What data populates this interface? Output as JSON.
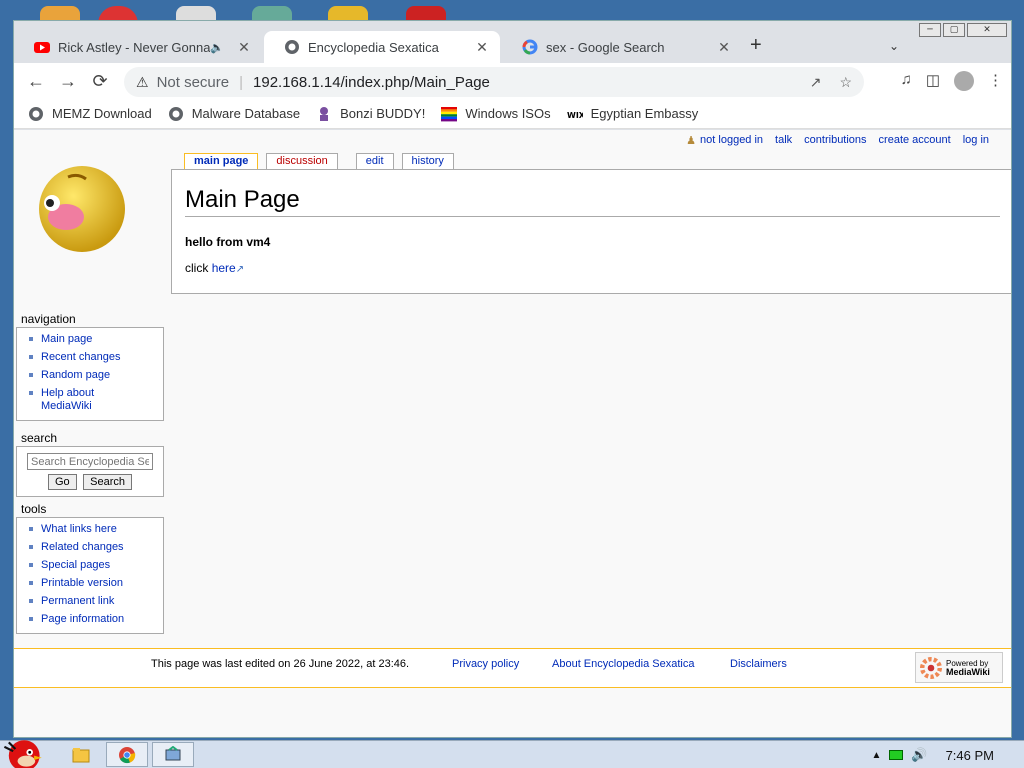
{
  "browser": {
    "tabs": [
      {
        "title": "Rick Astley - Never Gonna Give You Up",
        "icon": "youtube-icon",
        "audio": true,
        "active": false
      },
      {
        "title": "Encyclopedia Sexatica",
        "icon": "globe-icon",
        "active": true
      },
      {
        "title": "sex - Google Search",
        "icon": "google-icon",
        "active": false
      }
    ],
    "newtab_label": "+",
    "address": {
      "security_label": "Not secure",
      "url": "192.168.1.14/index.php/Main_Page"
    },
    "bookmarks": [
      {
        "label": "MEMZ Download",
        "icon": "globe-icon"
      },
      {
        "label": "Malware Database",
        "icon": "globe-icon"
      },
      {
        "label": "Bonzi BUDDY!",
        "icon": "bonzi-icon"
      },
      {
        "label": "Windows ISOs",
        "icon": "flag-icon"
      },
      {
        "label": "Egyptian Embassy",
        "icon": "wix-icon"
      }
    ]
  },
  "wiki": {
    "personal_links": [
      "not logged in",
      "talk",
      "contributions",
      "create account",
      "log in"
    ],
    "page_tabs": [
      "main page",
      "discussion",
      "edit",
      "history"
    ],
    "page_title": "Main Page",
    "greeting": "hello from vm4",
    "click_prefix": "click",
    "click_link": "here",
    "navigation": {
      "heading": "navigation",
      "items": [
        "Main page",
        "Recent changes",
        "Random page",
        "Help about MediaWiki"
      ]
    },
    "search": {
      "heading": "search",
      "placeholder": "Search Encyclopedia Sexatica",
      "go_label": "Go",
      "search_label": "Search"
    },
    "tools": {
      "heading": "tools",
      "items": [
        "What links here",
        "Related changes",
        "Special pages",
        "Printable version",
        "Permanent link",
        "Page information"
      ]
    },
    "footer": {
      "last_modified": "This page was last edited on 26 June 2022, at 23:46.",
      "privacy": "Privacy policy",
      "about": "About Encyclopedia Sexatica",
      "disclaimers": "Disclaimers",
      "powered_line1": "Powered by",
      "powered_line2": "MediaWiki"
    }
  },
  "taskbar": {
    "clock": "7:46 PM"
  },
  "colors": {
    "link": "#002bb8",
    "new_link": "#ba0000",
    "accent_border": "#fabd23"
  }
}
